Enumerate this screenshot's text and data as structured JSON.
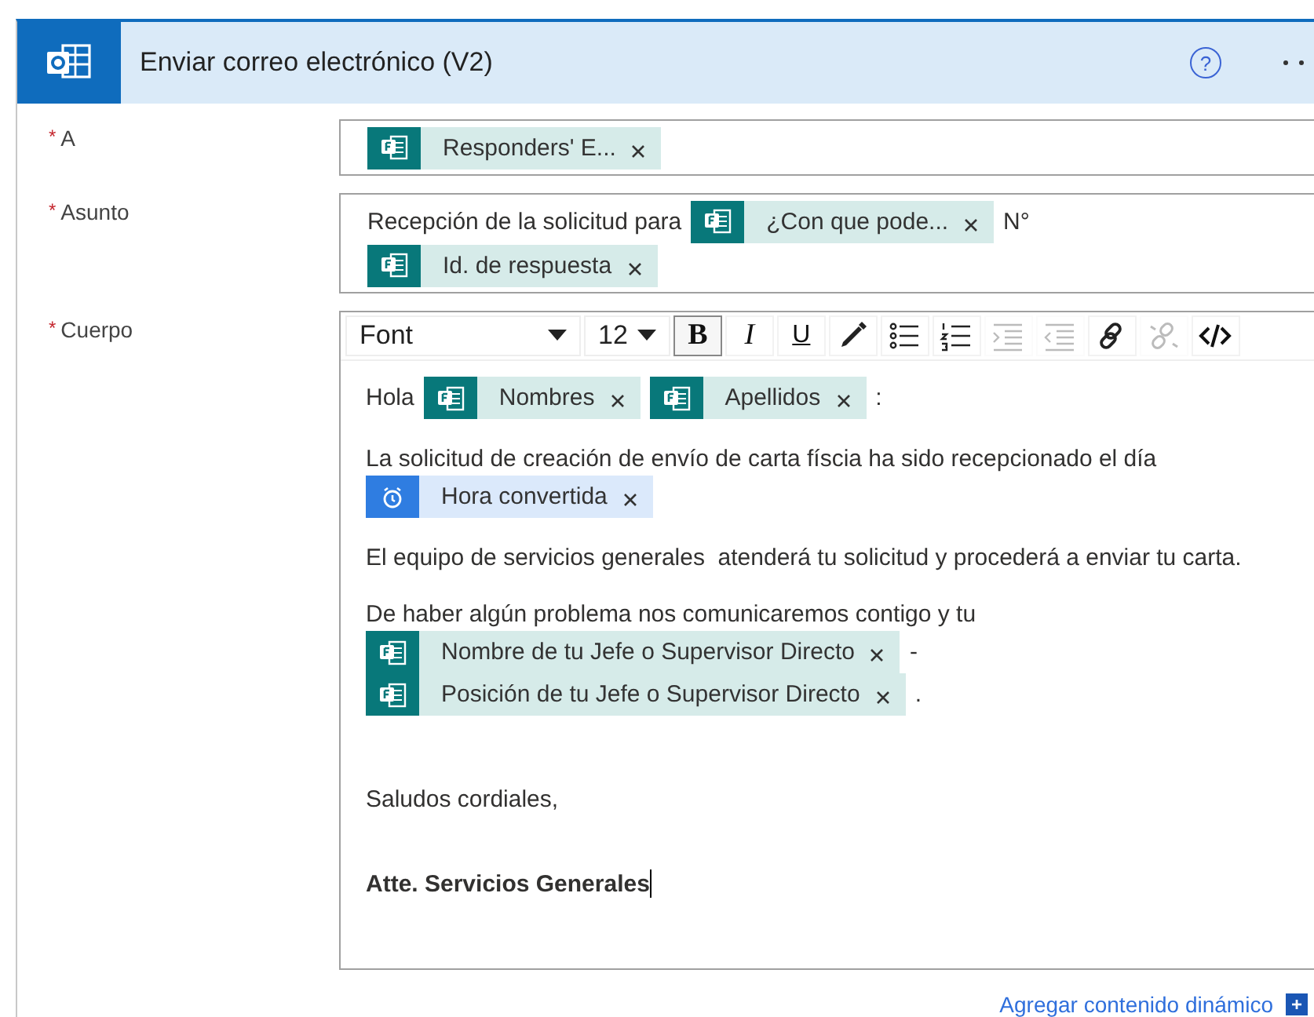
{
  "header": {
    "title": "Enviar correo electrónico (V2)",
    "help": "?"
  },
  "fields": [
    {
      "label": "A",
      "mark": "*",
      "kind": "tokens",
      "lines": [
        [
          {
            "kind": "token",
            "text": "Responders' E..."
          }
        ]
      ]
    },
    {
      "label": "Asunto",
      "mark": "*",
      "kind": "tokens",
      "lines": [
        [
          {
            "kind": "text",
            "text": "Recepción de la solicitud para"
          },
          {
            "kind": "token",
            "text": "¿Con que pode..."
          },
          {
            "kind": "text",
            "text": "N°"
          }
        ],
        [
          {
            "kind": "token",
            "text": "Id. de respuesta"
          }
        ]
      ]
    },
    {
      "label": "Cuerpo",
      "mark": "*",
      "kind": "editor"
    }
  ],
  "toolbar": [
    {
      "kind": "select",
      "label": "Font"
    },
    {
      "kind": "select",
      "label": "12"
    },
    {
      "kind": "glyph",
      "label": "B",
      "active": true,
      "disabled": false
    },
    {
      "kind": "glyph",
      "label": "I",
      "active": false,
      "disabled": false
    },
    {
      "kind": "glyph",
      "label": "U",
      "active": false,
      "disabled": false
    },
    {
      "kind": "icon",
      "active": false,
      "disabled": false
    },
    {
      "kind": "icon",
      "active": false,
      "disabled": false
    },
    {
      "kind": "icon",
      "active": false,
      "disabled": false
    },
    {
      "kind": "icon",
      "active": false,
      "disabled": true
    },
    {
      "kind": "icon",
      "active": false,
      "disabled": true
    },
    {
      "kind": "icon",
      "active": false,
      "disabled": false
    },
    {
      "kind": "icon",
      "active": false,
      "disabled": true
    },
    {
      "kind": "icon",
      "active": false,
      "disabled": false
    }
  ],
  "body": [
    {
      "bold": false,
      "lines": [
        [
          {
            "kind": "text",
            "text": "Hola"
          },
          {
            "kind": "token",
            "text": "Nombres"
          },
          {
            "kind": "token",
            "text": "Apellidos"
          },
          {
            "kind": "text",
            "text": ":"
          }
        ]
      ]
    },
    {
      "bold": false,
      "lines": [
        [
          {
            "kind": "text",
            "text": "La solicitud de creación de envío de carta físcia ha sido recepcionado el día"
          }
        ],
        [
          {
            "kind": "time-token",
            "text": "Hora convertida"
          }
        ]
      ]
    },
    {
      "bold": false,
      "lines": [
        [
          {
            "kind": "text",
            "text": "El equipo de servicios generales  atenderá tu solicitud y procederá a enviar tu carta."
          }
        ]
      ]
    },
    {
      "bold": false,
      "lines": [
        [
          {
            "kind": "text",
            "text": "De haber algún problema nos comunicaremos contigo y tu"
          }
        ],
        [
          {
            "kind": "token",
            "text": "Nombre de tu Jefe o Supervisor Directo"
          },
          {
            "kind": "text",
            "text": "-"
          }
        ],
        [
          {
            "kind": "token",
            "text": "Posición de tu Jefe o Supervisor Directo"
          },
          {
            "kind": "text",
            "text": "."
          }
        ]
      ]
    },
    {
      "bold": false,
      "lines": [
        [
          {
            "kind": "text",
            "text": "Saludos cordiales,"
          }
        ]
      ]
    },
    {
      "bold": true,
      "lines": [
        [
          {
            "kind": "text",
            "text": "Atte. Servicios Generales"
          }
        ]
      ]
    }
  ],
  "footer": {
    "link": "Agregar contenido dinámico",
    "add": "+"
  }
}
